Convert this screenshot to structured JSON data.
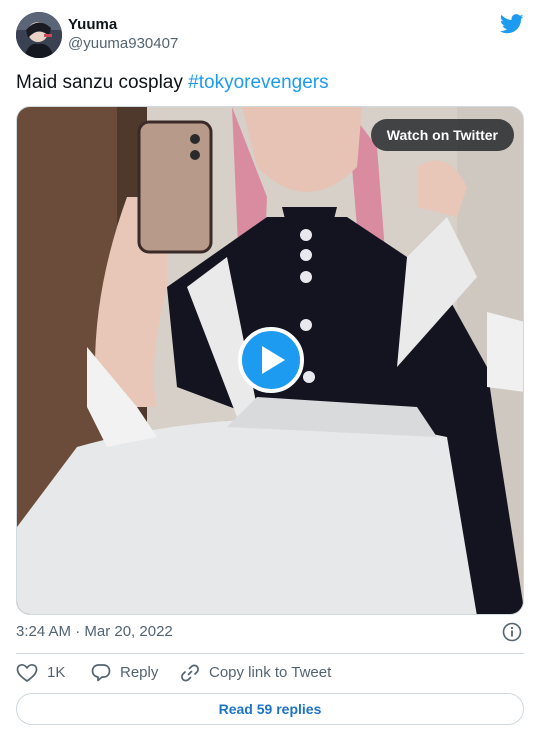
{
  "author": {
    "display_name": "Yuuma",
    "handle": "@yuuma930407",
    "avatar_icon": "avatar-photo"
  },
  "tweet": {
    "text": "Maid sanzu cosplay ",
    "hashtag": "#tokyorevengers"
  },
  "media": {
    "watch_label": "Watch on Twitter",
    "play_icon": "play-icon"
  },
  "meta": {
    "timestamp": "3:24 AM · Mar 20, 2022",
    "info_icon": "info-icon"
  },
  "actions": {
    "likes_count": "1K",
    "reply_label": "Reply",
    "copy_link_label": "Copy link to Tweet"
  },
  "read_replies_label": "Read 59 replies",
  "colors": {
    "brand_blue": "#1d9bf0",
    "text_primary": "#0f1419",
    "text_secondary": "#536471",
    "border": "#cfd9de"
  }
}
